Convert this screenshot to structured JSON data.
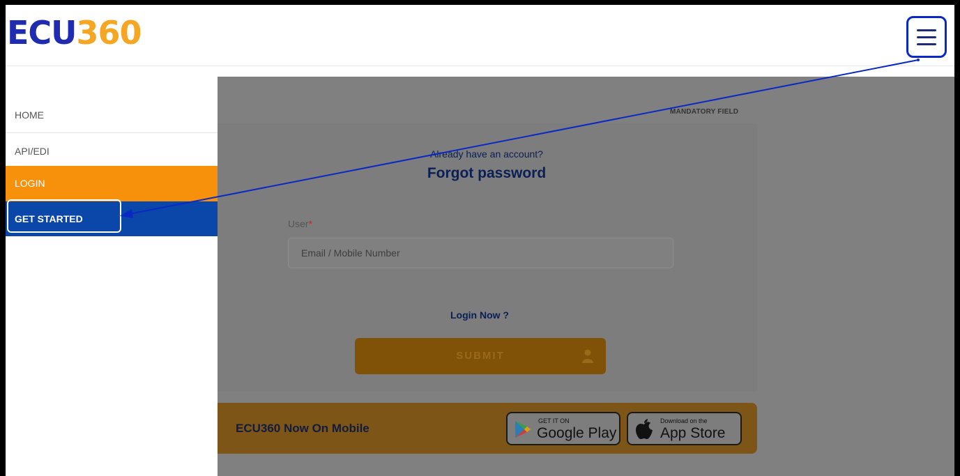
{
  "header": {
    "logo": {
      "part1": "ECU",
      "part2": "360",
      "color1": "#1f2bb0",
      "color2": "#f5a623"
    },
    "menu_icon": "hamburger-icon"
  },
  "sidebar": {
    "items": [
      {
        "label": "HOME"
      },
      {
        "label": "API/EDI"
      },
      {
        "label": "LOGIN",
        "color": "#f7900a"
      },
      {
        "label": "GET STARTED",
        "color": "#0b47a8"
      }
    ]
  },
  "form": {
    "mandatory": "MANDATORY FIELD",
    "already": "Already have an account?",
    "title": "Forgot password",
    "user_label": "User",
    "required_marker": "*",
    "user_placeholder": "Email / Mobile Number",
    "login_now": "Login Now ?",
    "submit_label": "SUBMIT",
    "submit_icon": "user-icon"
  },
  "banner": {
    "text": "ECU360 Now On Mobile",
    "google_play": {
      "small": "GET IT ON",
      "big": "Google Play"
    },
    "app_store": {
      "small": "Download on the",
      "big": "App Store"
    }
  },
  "annotation": {
    "arrow_color": "#0a29c4"
  }
}
